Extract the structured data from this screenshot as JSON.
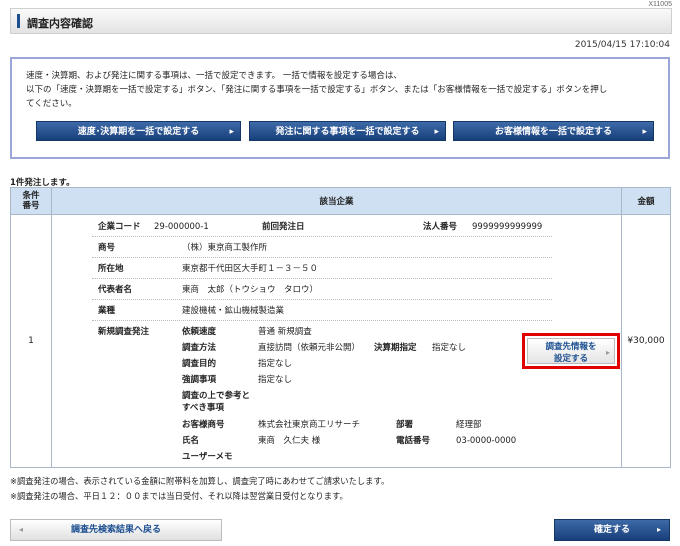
{
  "screen_id": "X11005",
  "header": {
    "title": "調査内容確認"
  },
  "datetime": "2015/04/15 17:10:04",
  "info": {
    "lines": [
      "速度・決算期、および発注に関する事項は、一括で設定できます。 一括で情報を設定する場合は、",
      "以下の「速度・決算期を一括で設定する」ボタン、「発注に関する事項を一括で設定する」ボタン、または「お客様情報を一括で設定する」ボタンを押し",
      "てください。"
    ],
    "btn_speed": "速度･決算期を一括で設定する",
    "btn_order": "発注に関する事項を一括で設定する",
    "btn_customer": "お客様情報を一括で設定する"
  },
  "count_label": "1件発注します。",
  "table": {
    "headers": {
      "cond": "条件\n番号",
      "company": "該当企業",
      "amount": "金額"
    },
    "row": {
      "cond_no": "1",
      "amount": "¥30,000",
      "company_code_label": "企業コード",
      "company_code": "29-000000-1",
      "prev_order_label": "前回発注日",
      "corp_no_label": "法人番号",
      "corp_no": "9999999999999",
      "name_label": "商号",
      "name": "（株）東京商工製作所",
      "address_label": "所在地",
      "address": "東京都千代田区大手町１－３－５０",
      "rep_label": "代表者名",
      "rep": "東商　太郎（トウショウ　タロウ）",
      "industry_label": "業種",
      "industry": "建設機械・鉱山機械製造業",
      "new_order_label": "新規調査発注",
      "order": {
        "speed_label": "依頼速度",
        "speed": "普通 新規調査",
        "method_label": "調査方法",
        "method": "直接訪問（依頼元非公開）",
        "fiscal_label": "決算期指定",
        "fiscal": "指定なし",
        "purpose_label": "調査目的",
        "purpose": "指定なし",
        "focus_label": "強調事項",
        "focus": "指定なし",
        "ref_label_1": "調査の上で参考と",
        "ref_label_2": "すべき事項",
        "customer_label": "お客様商号",
        "customer": "株式会社東京商工リサーチ",
        "dept_label": "部署",
        "dept": "経理部",
        "person_label": "氏名",
        "person": "東商　久仁夫 様",
        "phone_label": "電話番号",
        "phone": "03-0000-0000",
        "memo_label": "ユーザーメモ"
      },
      "set_btn": "調査先情報を\n設定する"
    }
  },
  "notes": [
    "※調査発注の場合、表示されている金額に附帯料を加算し、調査完了時にあわせてご請求いたします。",
    "※調査発注の場合、平日１２：００までは当日受付、それ以降は翌営業日受付となります。"
  ],
  "back_btn": "調査先検索結果へ戻る",
  "confirm_btn": "確定する"
}
